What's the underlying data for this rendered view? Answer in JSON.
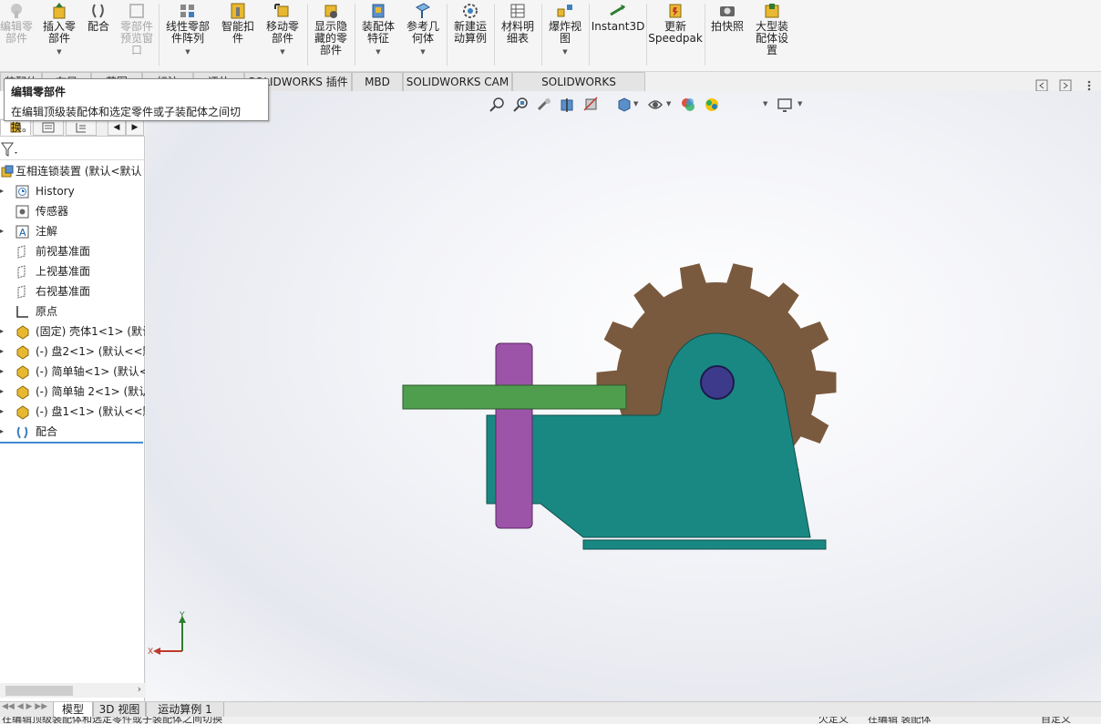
{
  "ribbon": {
    "buttons": [
      {
        "label": "编辑零\n部件",
        "icon": "edit-component-icon",
        "disabled": true
      },
      {
        "label": "插入零\n部件",
        "icon": "insert-component-icon"
      },
      {
        "label": "配合",
        "icon": "mate-icon"
      },
      {
        "label": "零部件\n预览窗\n口",
        "icon": "component-preview-icon",
        "disabled": true
      },
      {
        "label": "线性零部\n件阵列",
        "icon": "linear-pattern-icon"
      },
      {
        "label": "智能扣\n件",
        "icon": "smart-fasteners-icon"
      },
      {
        "label": "移动零\n部件",
        "icon": "move-component-icon"
      },
      {
        "label": "显示隐\n藏的零\n部件",
        "icon": "show-hidden-icon"
      },
      {
        "label": "装配体\n特征",
        "icon": "assembly-features-icon"
      },
      {
        "label": "参考几\n何体",
        "icon": "reference-geometry-icon"
      },
      {
        "label": "新建运\n动算例",
        "icon": "new-motion-study-icon"
      },
      {
        "label": "材料明\n细表",
        "icon": "bill-of-materials-icon"
      },
      {
        "label": "爆炸视\n图",
        "icon": "exploded-view-icon"
      },
      {
        "label": "Instant3D",
        "icon": "instant3d-icon"
      },
      {
        "label": "更新\nSpeedpak",
        "icon": "speedpak-icon"
      },
      {
        "label": "拍快照",
        "icon": "snapshot-icon"
      },
      {
        "label": "大型装\n配体设\n置",
        "icon": "large-assembly-icon"
      }
    ]
  },
  "command_tabs": [
    "装配体",
    "布局",
    "草图",
    "标注",
    "评估",
    "SOLIDWORKS 插件",
    "MBD",
    "SOLIDWORKS CAM",
    "SOLIDWORKS Inspection"
  ],
  "tooltip": {
    "title": "编辑零部件",
    "description": "在编辑顶级装配体和选定零件或子装配体之间切换。"
  },
  "tree": {
    "root": "互相连锁装置  (默认<默认",
    "items": [
      {
        "label": "History",
        "icon": "history-icon",
        "expandable": true
      },
      {
        "label": "传感器",
        "icon": "sensor-icon",
        "expandable": false
      },
      {
        "label": "注解",
        "icon": "annotation-icon",
        "expandable": true
      },
      {
        "label": "前视基准面",
        "icon": "plane-icon",
        "expandable": false
      },
      {
        "label": "上视基准面",
        "icon": "plane-icon",
        "expandable": false
      },
      {
        "label": "右视基准面",
        "icon": "plane-icon",
        "expandable": false
      },
      {
        "label": "原点",
        "icon": "origin-icon",
        "expandable": false
      },
      {
        "label": "(固定) 壳体1<1> (默认",
        "icon": "part-icon",
        "expandable": true
      },
      {
        "label": "(-) 盘2<1> (默认<<默",
        "icon": "part-icon",
        "expandable": true
      },
      {
        "label": "(-) 简单轴<1> (默认<",
        "icon": "part-icon",
        "expandable": true
      },
      {
        "label": "(-) 简单轴 2<1> (默认",
        "icon": "part-icon",
        "expandable": true
      },
      {
        "label": "(-) 盘1<1> (默认<<默",
        "icon": "part-icon",
        "expandable": true
      },
      {
        "label": "配合",
        "icon": "mates-folder-icon",
        "expandable": true
      }
    ]
  },
  "bottom_tabs": [
    "模型",
    "3D 视图",
    "运动算例 1"
  ],
  "status": {
    "left": "在编辑顶级装配体和选定零件或子装配体之间切换",
    "right1": "欠定义",
    "right2": "在编辑 装配体",
    "right3": "自定义"
  },
  "triad": {
    "x": "X",
    "y": "Y"
  },
  "colors": {
    "gear": "#7a5a3e",
    "housing": "#1a8882",
    "disc": "#4f9e4e",
    "shaft": "#9c54a8",
    "pin": "#3d3a8c",
    "accent": "#3f8bd1"
  }
}
